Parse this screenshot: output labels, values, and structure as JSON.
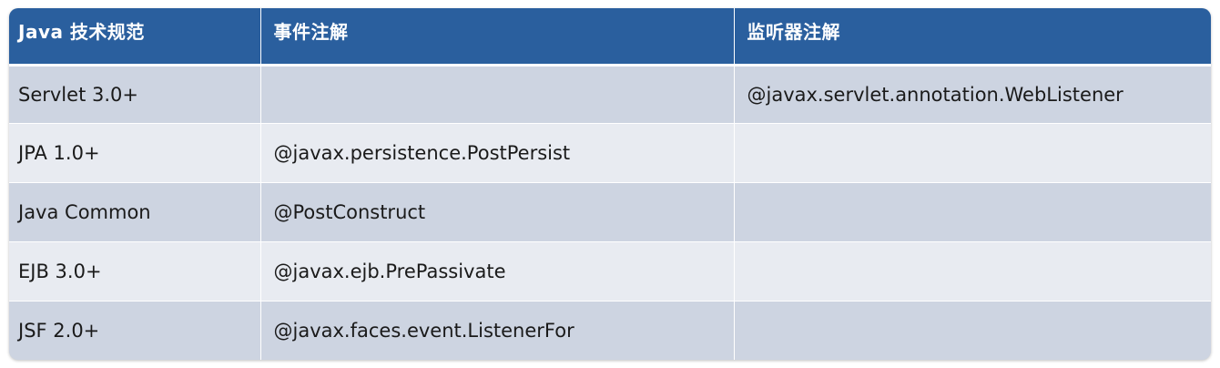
{
  "table": {
    "headers": [
      "Java 技术规范",
      "事件注解",
      "监听器注解"
    ],
    "rows": [
      [
        "Servlet 3.0+",
        "",
        "@javax.servlet.annotation.WebListener"
      ],
      [
        "JPA 1.0+",
        "@javax.persistence.PostPersist",
        ""
      ],
      [
        "Java Common",
        "@PostConstruct",
        ""
      ],
      [
        "EJB 3.0+",
        "@javax.ejb.PrePassivate",
        ""
      ],
      [
        "JSF 2.0+",
        "@javax.faces.event.ListenerFor",
        ""
      ]
    ]
  },
  "colors": {
    "header_bg": "#2a5f9e",
    "header_text": "#ffffff",
    "row_dark": "#cdd4e1",
    "row_light": "#e8ebf1"
  }
}
